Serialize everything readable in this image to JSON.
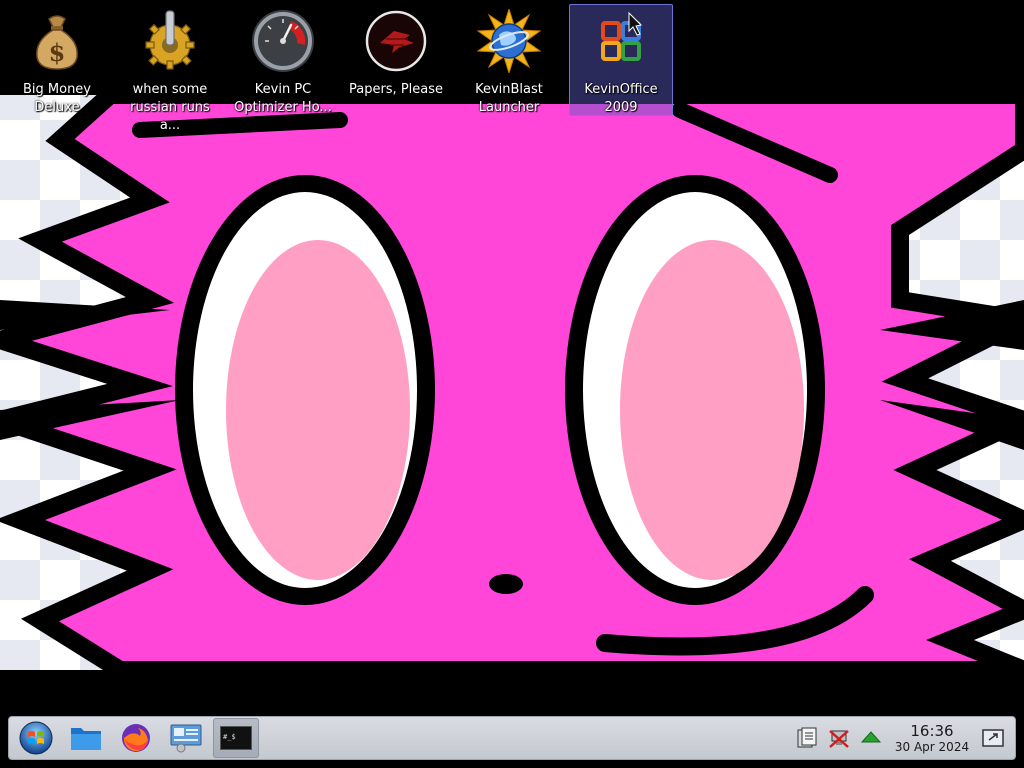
{
  "desktop": {
    "icons": [
      {
        "label": "Big Money\nDeluxe",
        "icon": "money-bag-icon"
      },
      {
        "label": "when some\nrussian runs a...",
        "icon": "gear-icon"
      },
      {
        "label": "Kevin PC\nOptimizer Ho...",
        "icon": "speedometer-icon"
      },
      {
        "label": "Papers, Please",
        "icon": "papers-please-icon"
      },
      {
        "label": "KevinBlast\nLauncher",
        "icon": "sun-globe-icon"
      },
      {
        "label": "KevinOffice\n2009",
        "icon": "office-logo-icon",
        "selected": true
      }
    ]
  },
  "taskbar": {
    "start_icon": "start-orb-icon",
    "pinned": [
      "file-manager-icon",
      "firefox-icon",
      "control-panel-icon",
      "terminal-icon"
    ],
    "tray": [
      "clipboard-icon",
      "network-disconnected-icon",
      "updates-arrow-icon"
    ],
    "clock": {
      "time": "16:36",
      "date": "30 Apr 2024"
    },
    "show_desktop_icon": "show-desktop-icon"
  },
  "colors": {
    "wallpaper_pink": "#ff46d8",
    "eye_pink": "#ff9fc4",
    "taskbar_bg": "#c8cbd1",
    "selection": "#5a5ac8"
  }
}
